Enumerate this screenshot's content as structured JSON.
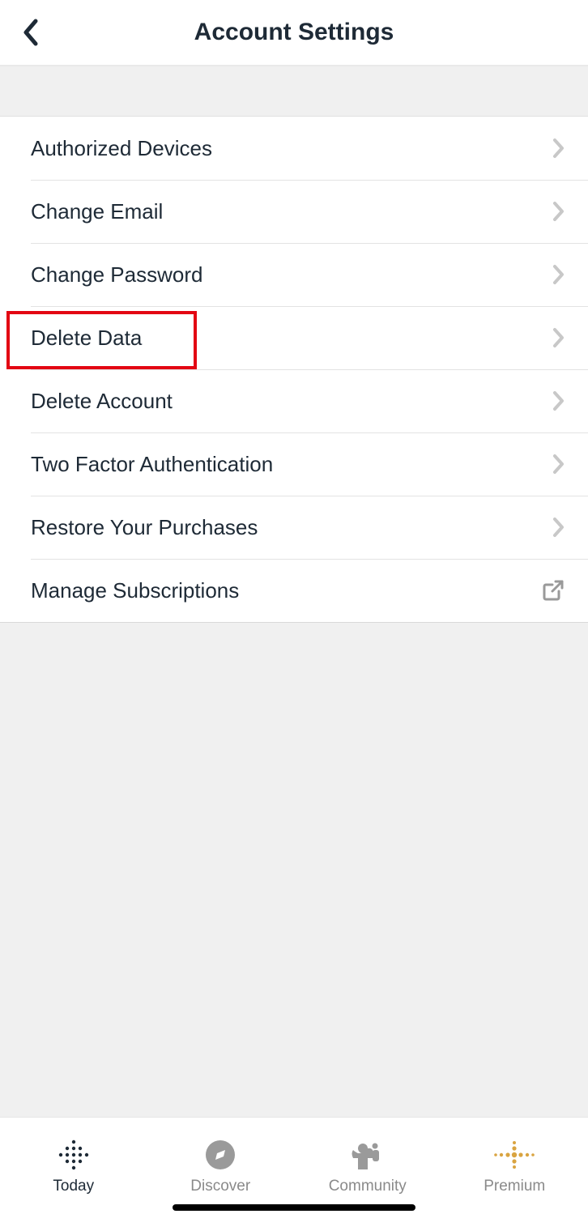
{
  "header": {
    "title": "Account Settings"
  },
  "settings": {
    "items": [
      {
        "label": "Authorized Devices",
        "icon": "chevron"
      },
      {
        "label": "Change Email",
        "icon": "chevron"
      },
      {
        "label": "Change Password",
        "icon": "chevron"
      },
      {
        "label": "Delete Data",
        "icon": "chevron"
      },
      {
        "label": "Delete Account",
        "icon": "chevron"
      },
      {
        "label": "Two Factor Authentication",
        "icon": "chevron"
      },
      {
        "label": "Restore Your Purchases",
        "icon": "chevron"
      },
      {
        "label": "Manage Subscriptions",
        "icon": "external"
      }
    ]
  },
  "highlight": {
    "target_index": 3
  },
  "tabbar": {
    "items": [
      {
        "label": "Today",
        "active": true
      },
      {
        "label": "Discover",
        "active": false
      },
      {
        "label": "Community",
        "active": false
      },
      {
        "label": "Premium",
        "active": false
      }
    ]
  }
}
